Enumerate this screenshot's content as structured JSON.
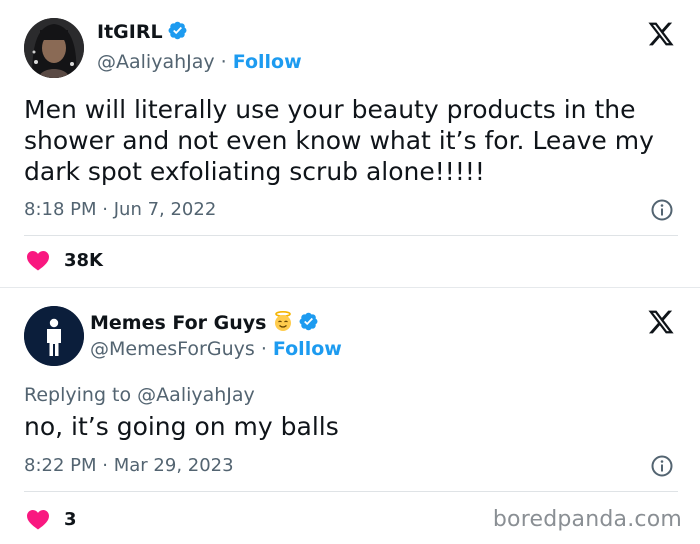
{
  "tweet1": {
    "name": "ItGIRL",
    "handle": "@AaliyahJay",
    "separator": "·",
    "follow_label": "Follow",
    "text": "Men will literally use your beauty products in the shower and not even know what it’s for. Leave my dark spot exfoliating scrub alone!!!!!",
    "time": "8:18 PM",
    "date": "Jun 7, 2022",
    "likes": "38K",
    "verified": true
  },
  "tweet2": {
    "name": "Memes For Guys",
    "name_emoji": "angel-face-emoji",
    "handle": "@MemesForGuys",
    "separator": "·",
    "follow_label": "Follow",
    "replying_prefix": "Replying to",
    "replying_to": "@AaliyahJay",
    "text": "no, it’s going on my balls",
    "time": "8:22 PM",
    "date": "Mar 29, 2023",
    "likes": "3",
    "verified": true
  },
  "watermark": "boredpanda.com",
  "colors": {
    "verified_blue": "#1d9bf0",
    "follow_blue": "#1d9bf0",
    "heart_pink": "#f91880",
    "text_primary": "#0f1419",
    "text_secondary": "#536471"
  },
  "icons": [
    "x-logo-icon",
    "verified-badge-icon",
    "info-icon",
    "heart-icon",
    "angel-face-emoji"
  ]
}
